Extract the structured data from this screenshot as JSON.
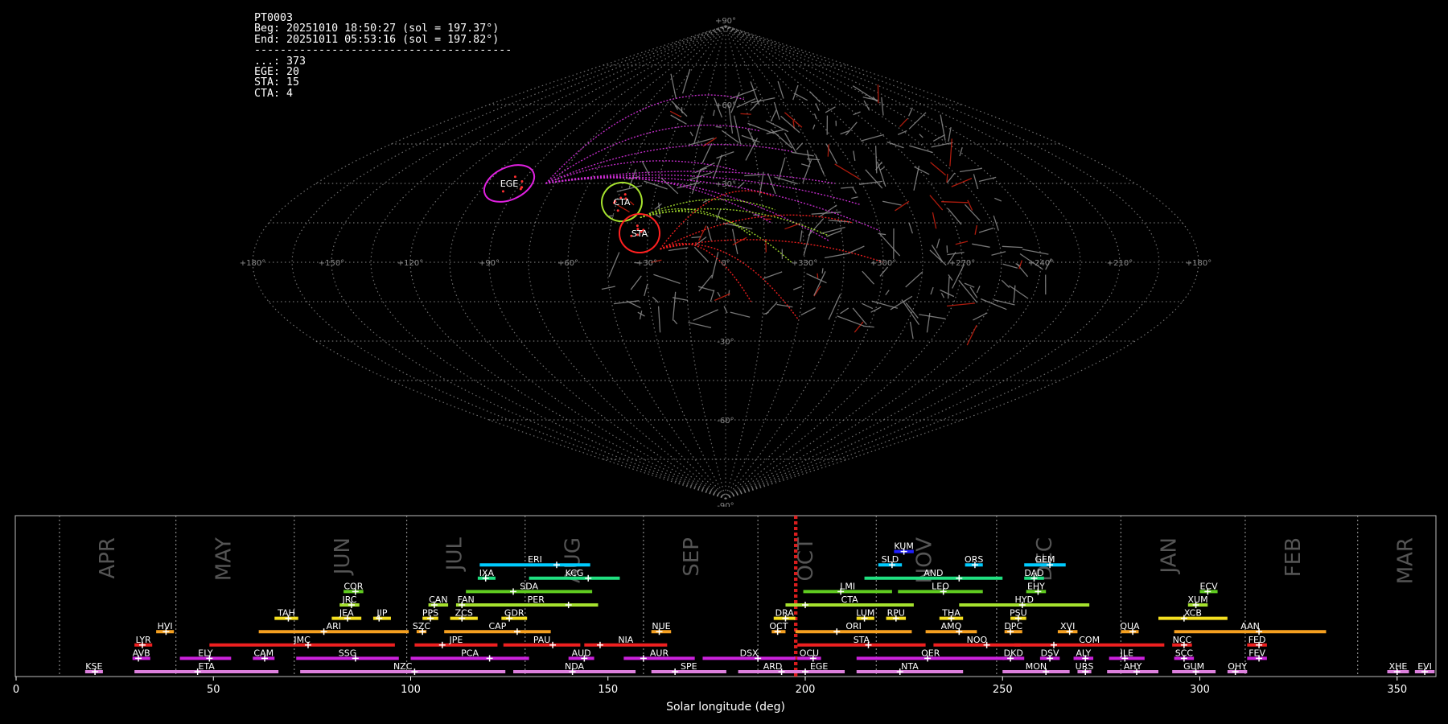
{
  "header": {
    "code": "PT0003",
    "beg": "Beg: 20251010 18:50:27 (sol = 197.37°)",
    "end": "End: 20251011 05:53:16 (sol = 197.82°)",
    "separator": "----------------------------------------",
    "counts": [
      "...: 373",
      "EGE: 20",
      "STA: 15",
      "CTA: 4"
    ]
  },
  "sky_map": {
    "projection": "sinusoidal",
    "lon_ticks": [
      "+180°",
      "+150°",
      "+120°",
      "+90°",
      "+60°",
      "+30°",
      "0°",
      "+330°",
      "+300°",
      "+270°",
      "+240°",
      "+210°",
      "+180°"
    ],
    "lat_ticks": [
      "+90°",
      "+60°",
      "+30°",
      "-30°",
      "-60°",
      "-90°"
    ],
    "radiants": [
      {
        "name": "EGE",
        "color": "#e020e0"
      },
      {
        "name": "CTA",
        "color": "#a6e22e"
      },
      {
        "name": "STA",
        "color": "#ff2020"
      }
    ]
  },
  "chart_data": {
    "type": "timeline",
    "xlabel": "Solar longitude (deg)",
    "xlim": [
      0,
      360
    ],
    "xticks": [
      0,
      50,
      100,
      150,
      200,
      250,
      300,
      350
    ],
    "current_sol": [
      197.37,
      197.82
    ],
    "months": [
      {
        "label": "APR",
        "start": 11,
        "end": 40.5
      },
      {
        "label": "MAY",
        "start": 40.5,
        "end": 70.5
      },
      {
        "label": "JUN",
        "start": 70.5,
        "end": 99
      },
      {
        "label": "JUL",
        "start": 99,
        "end": 129
      },
      {
        "label": "AUG",
        "start": 129,
        "end": 159
      },
      {
        "label": "SEP",
        "start": 159,
        "end": 188
      },
      {
        "label": "OCT",
        "start": 188,
        "end": 218
      },
      {
        "label": "NOV",
        "start": 218,
        "end": 248.5
      },
      {
        "label": "DEC",
        "start": 248.5,
        "end": 280
      },
      {
        "label": "JAN",
        "start": 280,
        "end": 311.5
      },
      {
        "label": "FEB",
        "start": 311.5,
        "end": 340
      },
      {
        "label": "MAR",
        "start": 340,
        "end": 371
      }
    ],
    "showers": [
      {
        "name": "KUM",
        "start": 222.5,
        "end": 227.5,
        "peak": 225,
        "row": 10,
        "color": "#2020ff"
      },
      {
        "name": "ERI",
        "start": 117.5,
        "end": 145.5,
        "peak": 137,
        "row": 9,
        "color": "#00ccff"
      },
      {
        "name": "SLD",
        "start": 218.5,
        "end": 224.5,
        "peak": 222,
        "row": 9,
        "color": "#00ccff"
      },
      {
        "name": "ORS",
        "start": 240.5,
        "end": 245,
        "peak": 243,
        "row": 9,
        "color": "#00ccff"
      },
      {
        "name": "GEM",
        "start": 255.5,
        "end": 266,
        "peak": 262,
        "row": 9,
        "color": "#00ccff"
      },
      {
        "name": "IXA",
        "start": 117,
        "end": 121.5,
        "peak": 119,
        "row": 8,
        "color": "#20e080"
      },
      {
        "name": "KCG",
        "start": 130,
        "end": 153,
        "peak": 145,
        "row": 8,
        "color": "#20e080"
      },
      {
        "name": "AND",
        "start": 215,
        "end": 250,
        "peak": 239,
        "row": 8,
        "color": "#20e080"
      },
      {
        "name": "DAD",
        "start": 255.5,
        "end": 260.5,
        "peak": 258,
        "row": 8,
        "color": "#20e080"
      },
      {
        "name": "COR",
        "start": 83,
        "end": 88,
        "peak": 86,
        "row": 7,
        "color": "#60cc20"
      },
      {
        "name": "SDA",
        "start": 114,
        "end": 146,
        "peak": 126,
        "row": 7,
        "color": "#60cc20"
      },
      {
        "name": "LMI",
        "start": 199.5,
        "end": 222,
        "peak": 209,
        "row": 7,
        "color": "#60cc20"
      },
      {
        "name": "LEO",
        "start": 223.5,
        "end": 245,
        "peak": 235,
        "row": 7,
        "color": "#60cc20"
      },
      {
        "name": "EHY",
        "start": 256,
        "end": 261,
        "peak": 259,
        "row": 7,
        "color": "#60cc20"
      },
      {
        "name": "ECV",
        "start": 300,
        "end": 304.5,
        "peak": 302,
        "row": 7,
        "color": "#60cc20"
      },
      {
        "name": "JRC",
        "start": 82,
        "end": 87,
        "peak": 85,
        "row": 6,
        "color": "#a6e22e"
      },
      {
        "name": "CAN",
        "start": 104.5,
        "end": 109.5,
        "peak": 106,
        "row": 6,
        "color": "#a6e22e"
      },
      {
        "name": "FAN",
        "start": 111.5,
        "end": 116.5,
        "peak": 113,
        "row": 6,
        "color": "#a6e22e"
      },
      {
        "name": "PER",
        "start": 116,
        "end": 147.5,
        "peak": 140,
        "row": 6,
        "color": "#a6e22e"
      },
      {
        "name": "CTA",
        "start": 195,
        "end": 227.5,
        "peak": 200,
        "row": 6,
        "color": "#a6e22e"
      },
      {
        "name": "HYD",
        "start": 239,
        "end": 272,
        "peak": 255,
        "row": 6,
        "color": "#a6e22e"
      },
      {
        "name": "XUM",
        "start": 297,
        "end": 302,
        "peak": 299,
        "row": 6,
        "color": "#a6e22e"
      },
      {
        "name": "TAH",
        "start": 65.5,
        "end": 71.5,
        "peak": 69,
        "row": 5,
        "color": "#f5e020"
      },
      {
        "name": "JEA",
        "start": 80,
        "end": 87.5,
        "peak": 84,
        "row": 5,
        "color": "#f5e020"
      },
      {
        "name": "JIP",
        "start": 90.5,
        "end": 95,
        "peak": 92,
        "row": 5,
        "color": "#f5e020"
      },
      {
        "name": "PPS",
        "start": 103,
        "end": 107,
        "peak": 105,
        "row": 5,
        "color": "#f5e020"
      },
      {
        "name": "ZCS",
        "start": 110,
        "end": 117,
        "peak": 113,
        "row": 5,
        "color": "#f5e020"
      },
      {
        "name": "GDR",
        "start": 123,
        "end": 129.5,
        "peak": 125,
        "row": 5,
        "color": "#f5e020"
      },
      {
        "name": "DRA",
        "start": 192,
        "end": 197.5,
        "peak": 195,
        "row": 5,
        "color": "#f5e020"
      },
      {
        "name": "LUM",
        "start": 213,
        "end": 217.5,
        "peak": 215,
        "row": 5,
        "color": "#f5e020"
      },
      {
        "name": "RPU",
        "start": 220.5,
        "end": 225.5,
        "peak": 223,
        "row": 5,
        "color": "#f5e020"
      },
      {
        "name": "THA",
        "start": 234,
        "end": 240,
        "peak": 237,
        "row": 5,
        "color": "#f5e020"
      },
      {
        "name": "PSU",
        "start": 252,
        "end": 256,
        "peak": 254,
        "row": 5,
        "color": "#f5e020"
      },
      {
        "name": "XCB",
        "start": 289.5,
        "end": 307,
        "peak": 296,
        "row": 5,
        "color": "#f5e020"
      },
      {
        "name": "HVI",
        "start": 35.5,
        "end": 40,
        "peak": 38,
        "row": 4,
        "color": "#f5a020"
      },
      {
        "name": "ARI",
        "start": 61.5,
        "end": 99.5,
        "peak": 78,
        "row": 4,
        "color": "#f5a020"
      },
      {
        "name": "SZC",
        "start": 101.5,
        "end": 104,
        "peak": 103,
        "row": 4,
        "color": "#f5a020"
      },
      {
        "name": "CAP",
        "start": 108.5,
        "end": 135.5,
        "peak": 127,
        "row": 4,
        "color": "#f5a020"
      },
      {
        "name": "NUE",
        "start": 161,
        "end": 166,
        "peak": 163,
        "row": 4,
        "color": "#f5a020"
      },
      {
        "name": "OCT",
        "start": 191.5,
        "end": 195,
        "peak": 193,
        "row": 4,
        "color": "#f5a020"
      },
      {
        "name": "ORI",
        "start": 197.5,
        "end": 227,
        "peak": 208,
        "row": 4,
        "color": "#f5a020"
      },
      {
        "name": "AMO",
        "start": 230.5,
        "end": 243.5,
        "peak": 239,
        "row": 4,
        "color": "#f5a020"
      },
      {
        "name": "DPC",
        "start": 250.5,
        "end": 255,
        "peak": 252,
        "row": 4,
        "color": "#f5a020"
      },
      {
        "name": "XVI",
        "start": 264,
        "end": 269,
        "peak": 267,
        "row": 4,
        "color": "#f5a020"
      },
      {
        "name": "QUA",
        "start": 280,
        "end": 284.5,
        "peak": 283,
        "row": 4,
        "color": "#f5a020"
      },
      {
        "name": "AAN",
        "start": 293.5,
        "end": 332,
        "peak": 315,
        "row": 4,
        "color": "#f5a020"
      },
      {
        "name": "LYR",
        "start": 30,
        "end": 34.5,
        "peak": 32,
        "row": 3,
        "color": "#ee2020"
      },
      {
        "name": "JMC",
        "start": 49,
        "end": 96,
        "peak": 74,
        "row": 3,
        "color": "#ee2020"
      },
      {
        "name": "JPE",
        "start": 101,
        "end": 122,
        "peak": 108,
        "row": 3,
        "color": "#ee2020"
      },
      {
        "name": "PAU",
        "start": 123.5,
        "end": 143,
        "peak": 136,
        "row": 3,
        "color": "#ee2020"
      },
      {
        "name": "NIA",
        "start": 144,
        "end": 165,
        "peak": 148,
        "row": 3,
        "color": "#ee2020"
      },
      {
        "name": "STA",
        "start": 198,
        "end": 230.5,
        "peak": 216,
        "row": 3,
        "color": "#ee2020"
      },
      {
        "name": "NOO",
        "start": 232.5,
        "end": 254.5,
        "peak": 246,
        "row": 3,
        "color": "#ee2020"
      },
      {
        "name": "COM",
        "start": 253,
        "end": 291,
        "peak": 263,
        "row": 3,
        "color": "#ee2020"
      },
      {
        "name": "NCC",
        "start": 293,
        "end": 298,
        "peak": 296,
        "row": 3,
        "color": "#ee2020"
      },
      {
        "name": "FED",
        "start": 312,
        "end": 317,
        "peak": 315,
        "row": 3,
        "color": "#ee2020"
      },
      {
        "name": "AVB",
        "start": 29.5,
        "end": 34,
        "peak": 31,
        "row": 2,
        "color": "#cc22dd"
      },
      {
        "name": "ELY",
        "start": 41.5,
        "end": 54.5,
        "peak": 49,
        "row": 2,
        "color": "#cc22dd"
      },
      {
        "name": "CAM",
        "start": 60,
        "end": 65.5,
        "peak": 63,
        "row": 2,
        "color": "#cc22dd"
      },
      {
        "name": "SSG",
        "start": 71,
        "end": 97,
        "peak": 86,
        "row": 2,
        "color": "#cc22dd"
      },
      {
        "name": "PCA",
        "start": 100,
        "end": 130,
        "peak": 120,
        "row": 2,
        "color": "#cc22dd"
      },
      {
        "name": "AUD",
        "start": 140,
        "end": 146.5,
        "peak": 144,
        "row": 2,
        "color": "#cc22dd"
      },
      {
        "name": "AUR",
        "start": 154,
        "end": 172,
        "peak": 159,
        "row": 2,
        "color": "#cc22dd"
      },
      {
        "name": "DSX",
        "start": 174,
        "end": 197.5,
        "peak": 188,
        "row": 2,
        "color": "#cc22dd"
      },
      {
        "name": "OCU",
        "start": 198,
        "end": 204,
        "peak": 202,
        "row": 2,
        "color": "#cc22dd"
      },
      {
        "name": "OER",
        "start": 213,
        "end": 250.5,
        "peak": 231,
        "row": 2,
        "color": "#cc22dd"
      },
      {
        "name": "DKD",
        "start": 250,
        "end": 255.5,
        "peak": 252,
        "row": 2,
        "color": "#cc22dd"
      },
      {
        "name": "DSV",
        "start": 259.5,
        "end": 264.5,
        "peak": 262,
        "row": 2,
        "color": "#cc22dd"
      },
      {
        "name": "ALY",
        "start": 268,
        "end": 273,
        "peak": 271,
        "row": 2,
        "color": "#cc22dd"
      },
      {
        "name": "JLE",
        "start": 277,
        "end": 286,
        "peak": 281,
        "row": 2,
        "color": "#cc22dd"
      },
      {
        "name": "SCC",
        "start": 293.5,
        "end": 298.5,
        "peak": 296,
        "row": 2,
        "color": "#cc22dd"
      },
      {
        "name": "FEV",
        "start": 312,
        "end": 317,
        "peak": 315,
        "row": 2,
        "color": "#cc22dd"
      },
      {
        "name": "KSE",
        "start": 17.5,
        "end": 22,
        "peak": 20,
        "row": 1,
        "color": "#dd80dd"
      },
      {
        "name": "ETA",
        "start": 30,
        "end": 66.5,
        "peak": 46,
        "row": 1,
        "color": "#dd80dd"
      },
      {
        "name": "NZC",
        "start": 72,
        "end": 124,
        "peak": 101,
        "row": 1,
        "color": "#dd80dd"
      },
      {
        "name": "NDA",
        "start": 126,
        "end": 157,
        "peak": 141,
        "row": 1,
        "color": "#dd80dd"
      },
      {
        "name": "SPE",
        "start": 161,
        "end": 180,
        "peak": 167,
        "row": 1,
        "color": "#dd80dd"
      },
      {
        "name": "ARD",
        "start": 183,
        "end": 200.5,
        "peak": 194,
        "row": 1,
        "color": "#dd80dd"
      },
      {
        "name": "EGE",
        "start": 197,
        "end": 210,
        "peak": 200,
        "row": 1,
        "color": "#dd80dd"
      },
      {
        "name": "NTA",
        "start": 213,
        "end": 240,
        "peak": 224,
        "row": 1,
        "color": "#dd80dd"
      },
      {
        "name": "MON",
        "start": 250,
        "end": 267,
        "peak": 261,
        "row": 1,
        "color": "#dd80dd"
      },
      {
        "name": "URS",
        "start": 269,
        "end": 272.5,
        "peak": 271,
        "row": 1,
        "color": "#dd80dd"
      },
      {
        "name": "AHY",
        "start": 276.5,
        "end": 289.5,
        "peak": 284,
        "row": 1,
        "color": "#dd80dd"
      },
      {
        "name": "GUM",
        "start": 293,
        "end": 304,
        "peak": 299,
        "row": 1,
        "color": "#dd80dd"
      },
      {
        "name": "OHY",
        "start": 307,
        "end": 312,
        "peak": 309,
        "row": 1,
        "color": "#dd80dd"
      },
      {
        "name": "XHE",
        "start": 347.5,
        "end": 353,
        "peak": 350,
        "row": 1,
        "color": "#dd80dd"
      },
      {
        "name": "EVI",
        "start": 354.5,
        "end": 359.5,
        "peak": 357,
        "row": 1,
        "color": "#dd80dd"
      }
    ]
  }
}
